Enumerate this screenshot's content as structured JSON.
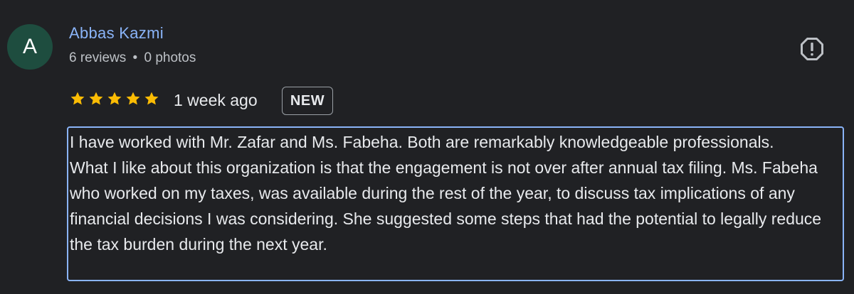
{
  "reviewer": {
    "avatar_letter": "A",
    "avatar_color": "#1e4d3f",
    "name": "Abbas Kazmi",
    "review_count": "6 reviews",
    "separator": "•",
    "photo_count": "0 photos"
  },
  "report_icon": "report-flag-icon",
  "rating": {
    "stars": 5,
    "max_stars": 5,
    "star_color": "#fbbc04"
  },
  "time_ago": "1 week ago",
  "badge": "NEW",
  "review_text": "I have worked with Mr. Zafar and Ms. Fabeha. Both are remarkably knowledgeable professionals.\nWhat I like about this organization is that the engagement is not over after annual tax filing. Ms. Fabeha who worked on my taxes, was available during the rest of the year, to discuss tax implications of any financial decisions I was considering. She suggested some steps that had the potential to legally reduce the tax burden during the next year.",
  "colors": {
    "background": "#202124",
    "link": "#8ab4f8",
    "text": "#e8eaed",
    "secondary_text": "#bdc1c6"
  }
}
